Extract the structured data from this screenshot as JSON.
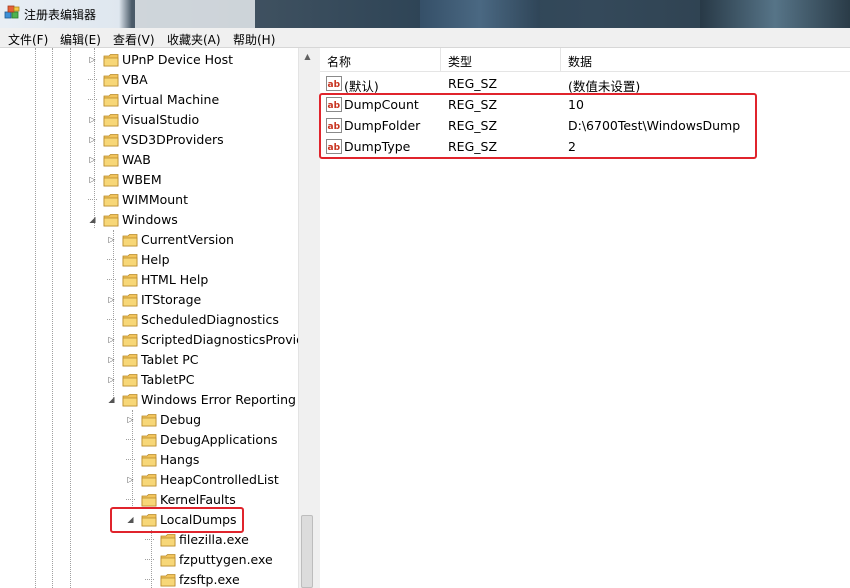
{
  "window": {
    "title": "注册表编辑器",
    "icon": "registry-editor-icon"
  },
  "menu": [
    {
      "label": "文件(F)"
    },
    {
      "label": "编辑(E)"
    },
    {
      "label": "查看(V)"
    },
    {
      "label": "收藏夹(A)"
    },
    {
      "label": "帮助(H)"
    }
  ],
  "tree": {
    "items": [
      {
        "label": "UPnP Device Host",
        "level": 0,
        "expander": "collapsed"
      },
      {
        "label": "VBA",
        "level": 0,
        "expander": "none"
      },
      {
        "label": "Virtual Machine",
        "level": 0,
        "expander": "none"
      },
      {
        "label": "VisualStudio",
        "level": 0,
        "expander": "collapsed"
      },
      {
        "label": "VSD3DProviders",
        "level": 0,
        "expander": "collapsed"
      },
      {
        "label": "WAB",
        "level": 0,
        "expander": "collapsed"
      },
      {
        "label": "WBEM",
        "level": 0,
        "expander": "collapsed"
      },
      {
        "label": "WIMMount",
        "level": 0,
        "expander": "none"
      },
      {
        "label": "Windows",
        "level": 0,
        "expander": "expanded"
      },
      {
        "label": "CurrentVersion",
        "level": 1,
        "expander": "collapsed"
      },
      {
        "label": "Help",
        "level": 1,
        "expander": "none"
      },
      {
        "label": "HTML Help",
        "level": 1,
        "expander": "none"
      },
      {
        "label": "ITStorage",
        "level": 1,
        "expander": "collapsed"
      },
      {
        "label": "ScheduledDiagnostics",
        "level": 1,
        "expander": "none"
      },
      {
        "label": "ScriptedDiagnosticsProvide",
        "level": 1,
        "expander": "collapsed"
      },
      {
        "label": "Tablet PC",
        "level": 1,
        "expander": "collapsed"
      },
      {
        "label": "TabletPC",
        "level": 1,
        "expander": "collapsed"
      },
      {
        "label": "Windows Error Reporting",
        "level": 1,
        "expander": "expanded"
      },
      {
        "label": "Debug",
        "level": 2,
        "expander": "collapsed"
      },
      {
        "label": "DebugApplications",
        "level": 2,
        "expander": "none"
      },
      {
        "label": "Hangs",
        "level": 2,
        "expander": "none"
      },
      {
        "label": "HeapControlledList",
        "level": 2,
        "expander": "collapsed"
      },
      {
        "label": "KernelFaults",
        "level": 2,
        "expander": "none"
      },
      {
        "label": "LocalDumps",
        "level": 2,
        "expander": "expanded",
        "highlighted": true
      },
      {
        "label": "filezilla.exe",
        "level": 3,
        "expander": "none"
      },
      {
        "label": "fzputtygen.exe",
        "level": 3,
        "expander": "none"
      },
      {
        "label": "fzsftp.exe",
        "level": 3,
        "expander": "none"
      }
    ]
  },
  "values": {
    "columns": [
      {
        "label": "名称"
      },
      {
        "label": "类型"
      },
      {
        "label": "数据"
      }
    ],
    "rows": [
      {
        "name": "(默认)",
        "type": "REG_SZ",
        "data": "(数值未设置)",
        "icon": "string-value-icon"
      },
      {
        "name": "DumpCount",
        "type": "REG_SZ",
        "data": "10",
        "icon": "string-value-icon",
        "highlighted": true
      },
      {
        "name": "DumpFolder",
        "type": "REG_SZ",
        "data": "D:\\6700Test\\WindowsDump",
        "icon": "string-value-icon",
        "highlighted": true
      },
      {
        "name": "DumpType",
        "type": "REG_SZ",
        "data": "2",
        "icon": "string-value-icon",
        "highlighted": true
      }
    ]
  },
  "colors": {
    "highlight_border": "#e0242c",
    "folder": "#e8b84a"
  }
}
